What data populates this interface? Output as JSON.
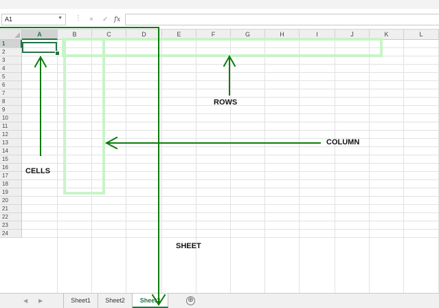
{
  "formula_bar": {
    "name_box": "A1",
    "cancel_icon": "×",
    "enter_icon": "✓",
    "fx_icon": "fx",
    "value": ""
  },
  "grid": {
    "columns": [
      "A",
      "B",
      "C",
      "D",
      "E",
      "F",
      "G",
      "H",
      "I",
      "J",
      "K",
      "L"
    ],
    "rows": [
      "1",
      "2",
      "3",
      "4",
      "5",
      "6",
      "7",
      "8",
      "9",
      "10",
      "11",
      "12",
      "13",
      "14",
      "15",
      "16",
      "17",
      "18",
      "19",
      "20",
      "21",
      "22",
      "23",
      "24"
    ],
    "selected_cell": "A1"
  },
  "sheet_tabs": {
    "tabs": [
      "Sheet1",
      "Sheet2",
      "Sheet3"
    ],
    "active": "Sheet3",
    "add_icon": "⊕",
    "prev_icon": "◀",
    "next_icon": "▶"
  },
  "annotations": {
    "cells": "CELLS",
    "rows": "ROWS",
    "column": "COLUMN",
    "sheet": "SHEET",
    "color": "#0a7a0a",
    "highlight_color": "#c8f4c8"
  }
}
